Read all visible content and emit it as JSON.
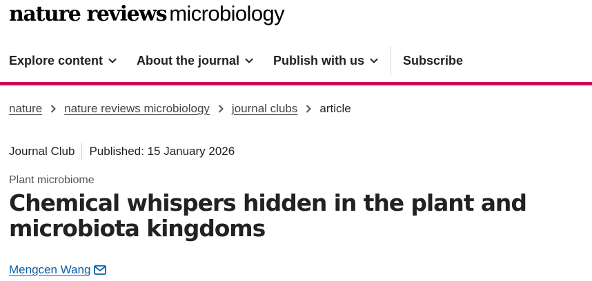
{
  "site": {
    "logo_bold": "nature reviews",
    "logo_light": "microbiology"
  },
  "nav": {
    "items": [
      {
        "label": "Explore content",
        "icon": "chevron-down-icon"
      },
      {
        "label": "About the journal",
        "icon": "chevron-down-icon"
      },
      {
        "label": "Publish with us",
        "icon": "chevron-down-icon"
      }
    ],
    "subscribe": "Subscribe"
  },
  "colors": {
    "accent_bar": "#d6005a",
    "link": "#0b5ea8"
  },
  "breadcrumb": {
    "items": [
      "nature",
      "nature reviews microbiology",
      "journal clubs"
    ],
    "current": "article",
    "separator_icon": "chevron-right-icon"
  },
  "article": {
    "type": "Journal Club",
    "published": "Published: 15 January 2026",
    "subject": "Plant microbiome",
    "title": "Chemical whispers hidden in the plant and microbiota kingdoms",
    "author": "Mengcen Wang",
    "author_icon": "mail-icon"
  }
}
